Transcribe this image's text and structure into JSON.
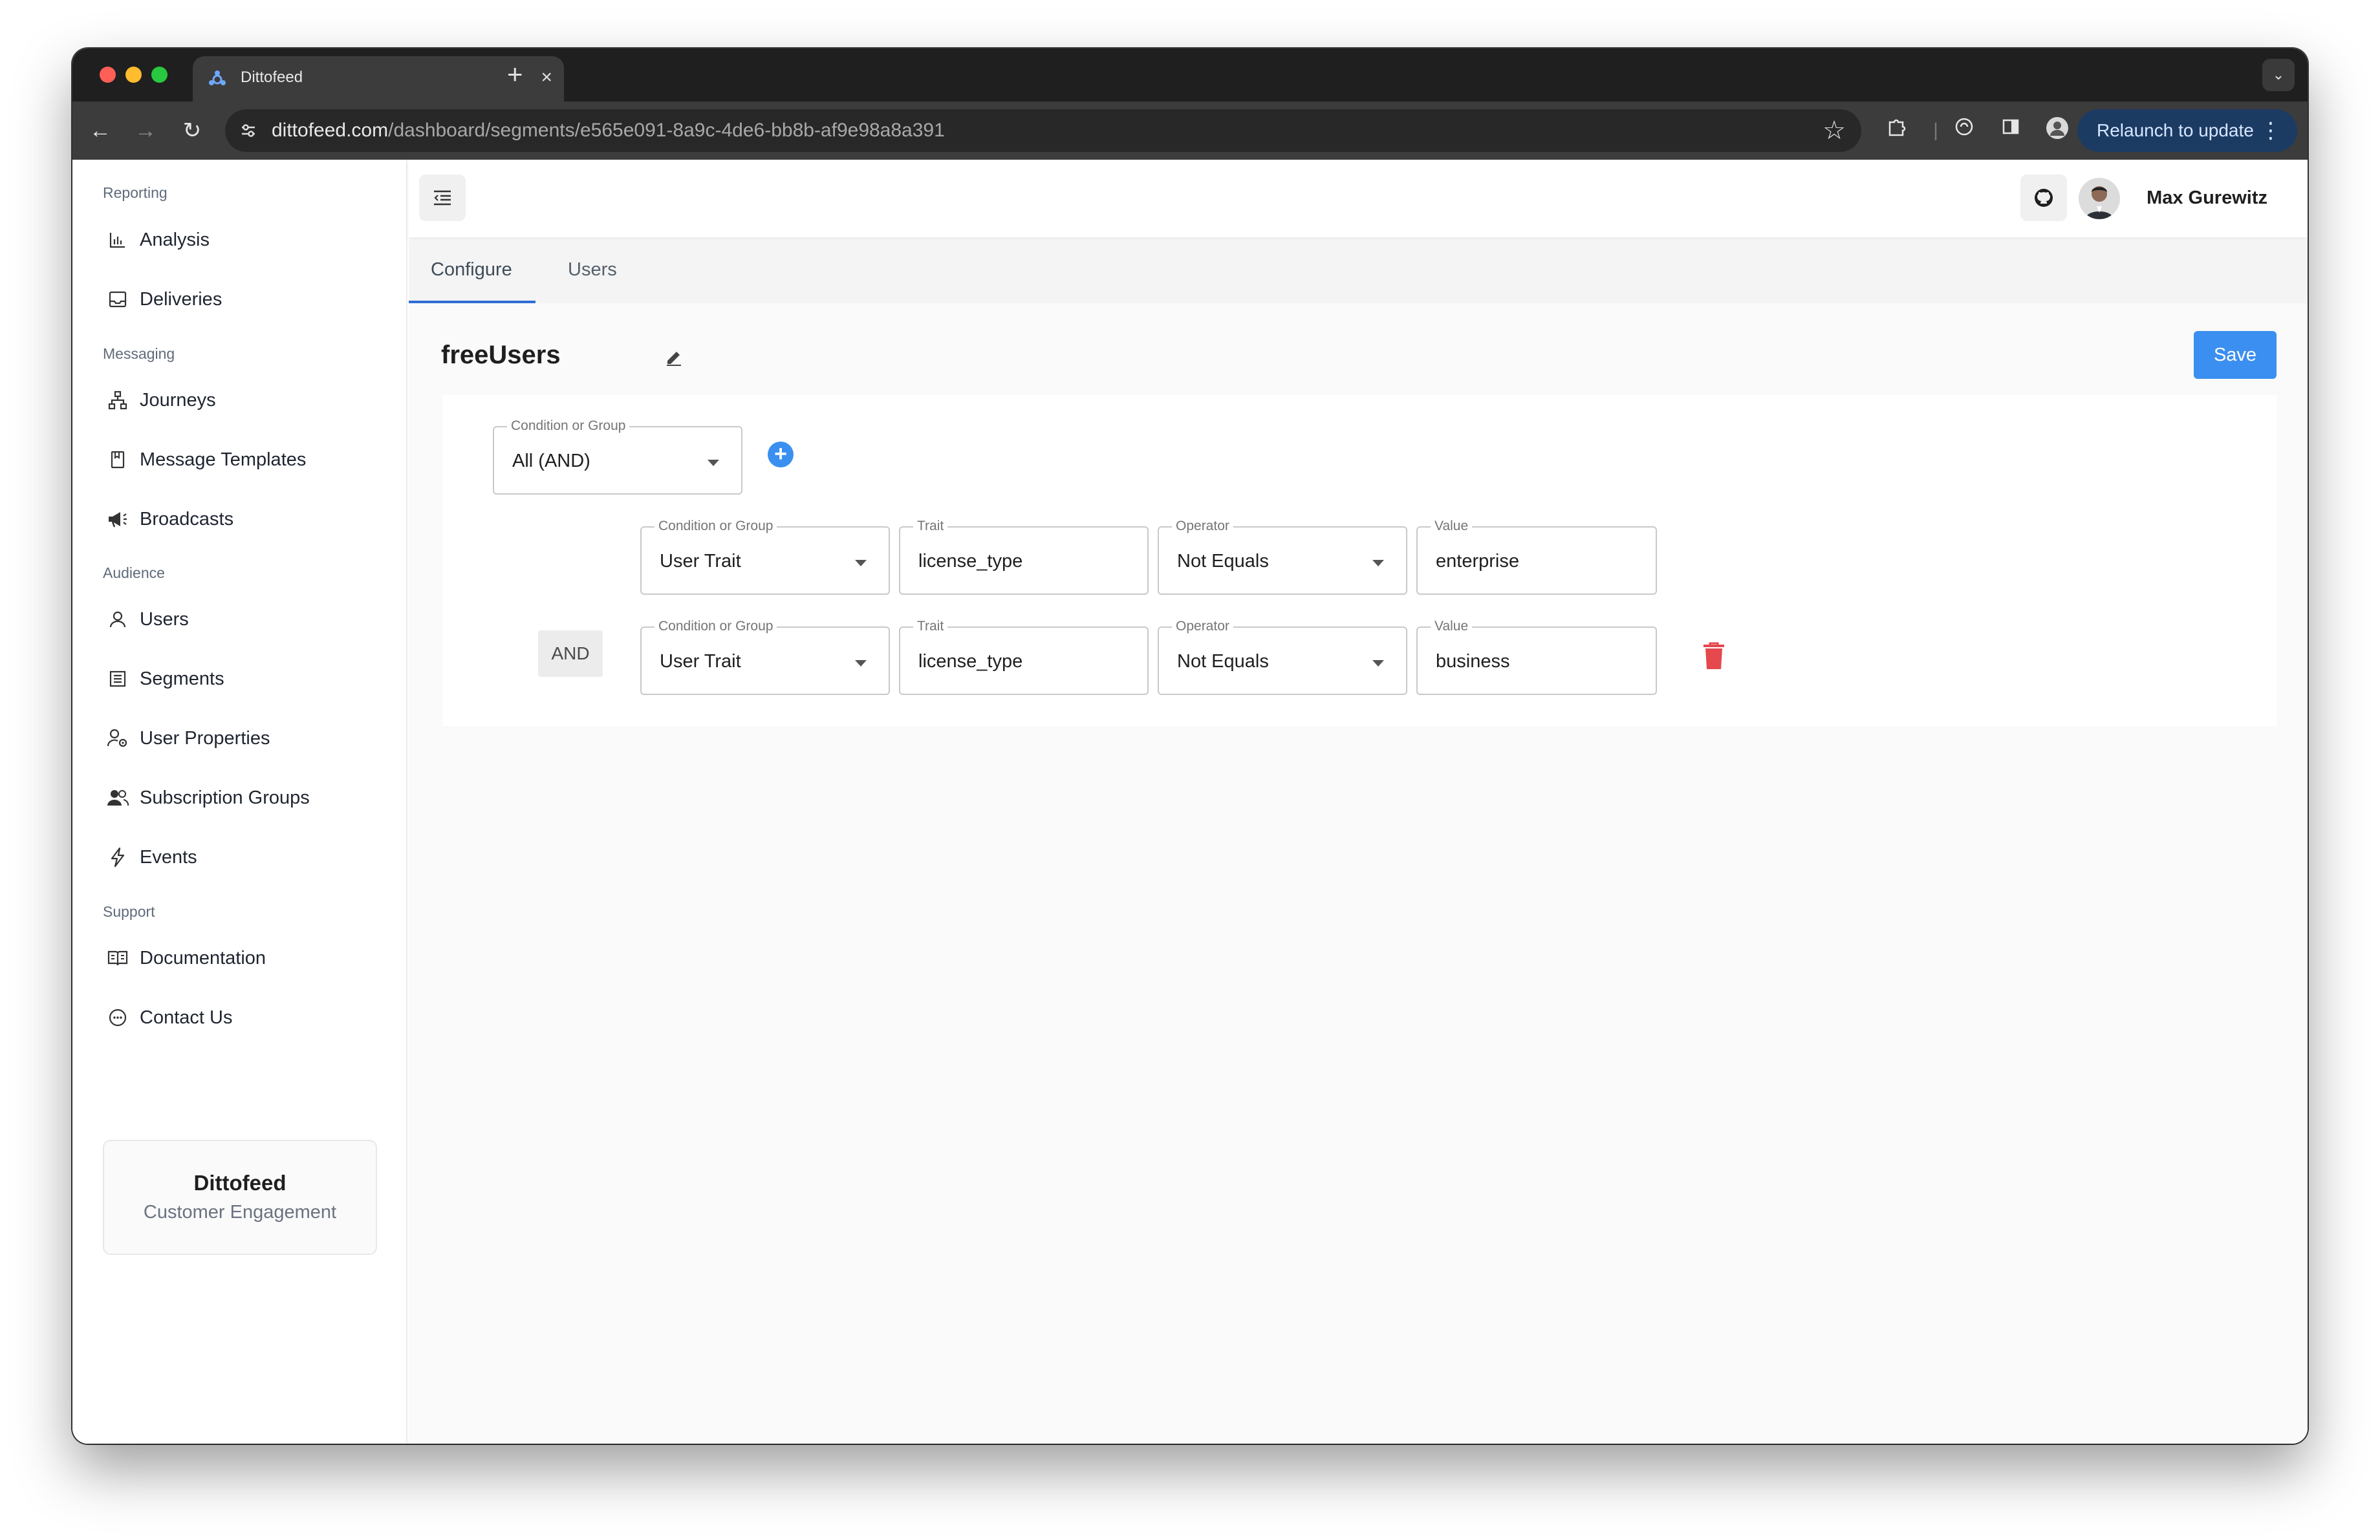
{
  "browser": {
    "tab_title": "Dittofeed",
    "url_host": "dittofeed.com",
    "url_path": "/dashboard/segments/e565e091-8a9c-4de6-bb8b-af9e98a8a391",
    "relaunch_label": "Relaunch to update"
  },
  "sidebar": {
    "sections": [
      {
        "title": "Reporting",
        "items": [
          "Analysis",
          "Deliveries"
        ]
      },
      {
        "title": "Messaging",
        "items": [
          "Journeys",
          "Message Templates",
          "Broadcasts"
        ]
      },
      {
        "title": "Audience",
        "items": [
          "Users",
          "Segments",
          "User Properties",
          "Subscription Groups",
          "Events"
        ]
      },
      {
        "title": "Support",
        "items": [
          "Documentation",
          "Contact Us"
        ]
      }
    ],
    "brand": {
      "title": "Dittofeed",
      "subtitle": "Customer Engagement"
    }
  },
  "header": {
    "user_name": "Max Gurewitz"
  },
  "page_tabs": [
    "Configure",
    "Users"
  ],
  "segment": {
    "name": "freeUsers",
    "save_label": "Save",
    "root": {
      "label": "Condition or Group",
      "value": "All (AND)"
    },
    "join_label": "AND",
    "labels": {
      "condition": "Condition or Group",
      "trait": "Trait",
      "operator": "Operator",
      "value": "Value"
    },
    "conditions": [
      {
        "condition": "User Trait",
        "trait": "license_type",
        "operator": "Not Equals",
        "value": "enterprise"
      },
      {
        "condition": "User Trait",
        "trait": "license_type",
        "operator": "Not Equals",
        "value": "business"
      }
    ]
  },
  "colors": {
    "accent": "#3b8ff0",
    "delete": "#e5484d",
    "tab_indicator": "#2f6fd6"
  }
}
